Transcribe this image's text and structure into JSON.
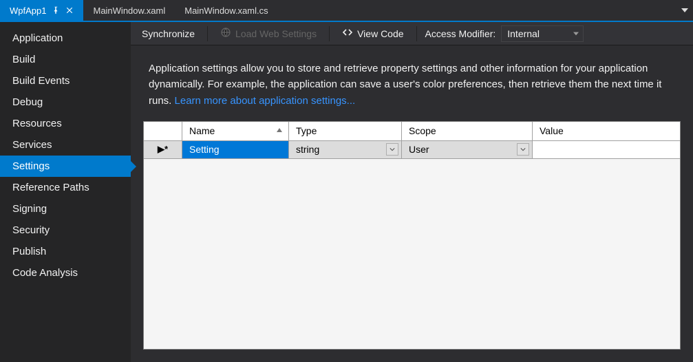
{
  "tabs": {
    "active": "WpfApp1",
    "items": [
      "MainWindow.xaml",
      "MainWindow.xaml.cs"
    ]
  },
  "sidebar": {
    "items": [
      "Application",
      "Build",
      "Build Events",
      "Debug",
      "Resources",
      "Services",
      "Settings",
      "Reference Paths",
      "Signing",
      "Security",
      "Publish",
      "Code Analysis"
    ],
    "selected": "Settings"
  },
  "toolbar": {
    "synchronize": "Synchronize",
    "load_web": "Load Web Settings",
    "view_code": "View Code",
    "access_modifier_label": "Access Modifier:",
    "access_modifier_value": "Internal"
  },
  "description": {
    "text": "Application settings allow you to store and retrieve property settings and other information for your application dynamically. For example, the application can save a user's color preferences, then retrieve them the next time it runs.  ",
    "link": "Learn more about application settings..."
  },
  "grid": {
    "columns": {
      "name": "Name",
      "type": "Type",
      "scope": "Scope",
      "value": "Value"
    },
    "rows": [
      {
        "name": "Setting",
        "type": "string",
        "scope": "User",
        "value": ""
      }
    ],
    "new_row_marker": "▶*"
  }
}
